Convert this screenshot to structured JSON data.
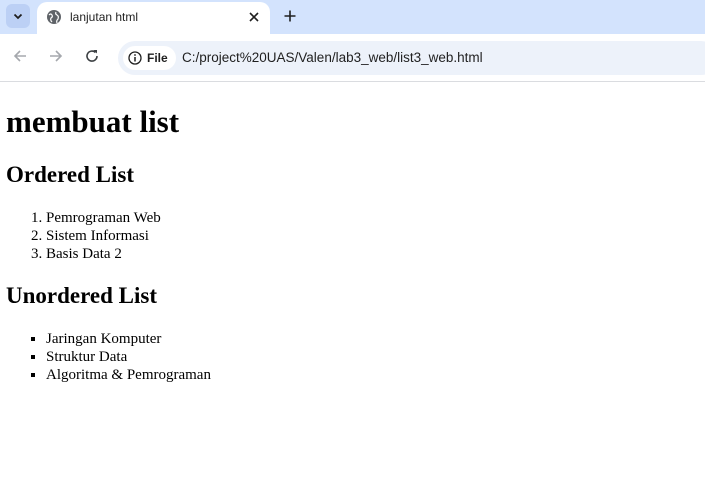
{
  "browser": {
    "tab": {
      "title": "lanjutan html",
      "favicon": "globe-icon"
    },
    "toolbar": {
      "back_icon": "arrow-left-icon",
      "forward_icon": "arrow-right-icon",
      "reload_icon": "reload-icon",
      "site_chip_label": "File",
      "site_chip_icon": "info-icon",
      "url": "C:/project%20UAS/Valen/lab3_web/list3_web.html"
    },
    "colors": {
      "tabstrip": "#d3e3fd",
      "omnibox": "#edf2fa",
      "page": "#ffffff"
    }
  },
  "page": {
    "title": "membuat list",
    "ordered": {
      "heading": "Ordered List",
      "items": [
        "Pemrograman Web",
        "Sistem Informasi",
        "Basis Data 2"
      ]
    },
    "unordered": {
      "heading": "Unordered List",
      "items": [
        "Jaringan Komputer",
        "Struktur Data",
        "Algoritma & Pemrograman"
      ]
    }
  }
}
